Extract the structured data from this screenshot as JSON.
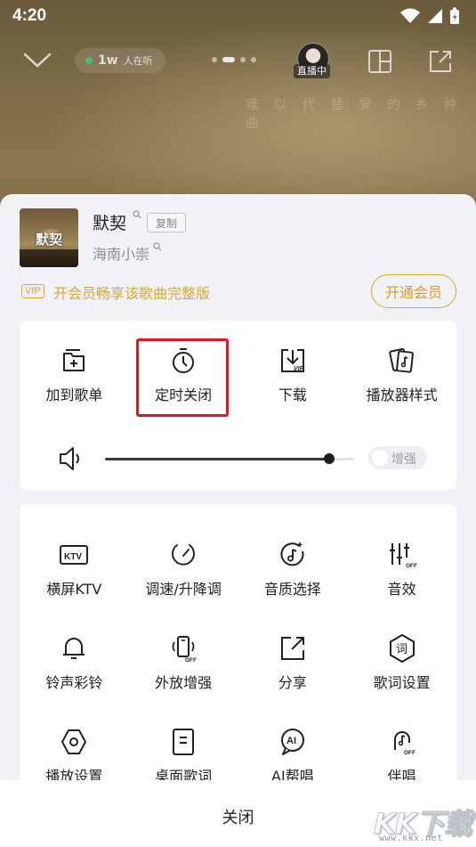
{
  "status_bar": {
    "time": "4:20"
  },
  "player": {
    "listeners_count": "1w",
    "listeners_label": "人在听",
    "live_badge": "直播中",
    "background_lyric": "难 以 代 替   爱 的 乡 种 曲"
  },
  "song": {
    "cover_text": "默契",
    "title": "默契",
    "copy_label": "复制",
    "artist": "海南小崇"
  },
  "vip": {
    "tag": "VIP",
    "promo": "开会员畅享该歌曲完整版",
    "button": "开通会员"
  },
  "quick_actions": [
    {
      "icon": "add-to-playlist-icon",
      "label": "加到歌单"
    },
    {
      "icon": "timer-icon",
      "label": "定时关闭"
    },
    {
      "icon": "vip-download-icon",
      "label": "下载"
    },
    {
      "icon": "player-style-icon",
      "label": "播放器样式"
    }
  ],
  "volume": {
    "level": 0.9,
    "boost_label": "增强",
    "boost_on": false
  },
  "more_actions": [
    {
      "icon": "ktv-icon",
      "label": "横屏KTV"
    },
    {
      "icon": "speed-gauge-icon",
      "label": "调速/升降调"
    },
    {
      "icon": "audio-quality-icon",
      "label": "音质选择"
    },
    {
      "icon": "equalizer-icon",
      "label": "音效"
    },
    {
      "icon": "bell-icon",
      "label": "铃声彩铃"
    },
    {
      "icon": "speaker-boost-icon",
      "label": "外放增强"
    },
    {
      "icon": "share-icon",
      "label": "分享"
    },
    {
      "icon": "lyrics-settings-icon",
      "label": "歌词设置"
    },
    {
      "icon": "play-settings-icon",
      "label": "播放设置"
    },
    {
      "icon": "desktop-lyrics-icon",
      "label": "桌面歌词"
    },
    {
      "icon": "ai-sing-icon",
      "label": "AI帮唱"
    },
    {
      "icon": "accompaniment-icon",
      "label": "伴唱"
    }
  ],
  "footer": {
    "close_label": "关闭"
  },
  "watermark": {
    "logo": "KK下载",
    "url": "www.kkx.net"
  },
  "colors": {
    "accent_gold": "#e0a430",
    "highlight_red": "#e8141c",
    "sheet_bg": "#f1f2f5"
  }
}
